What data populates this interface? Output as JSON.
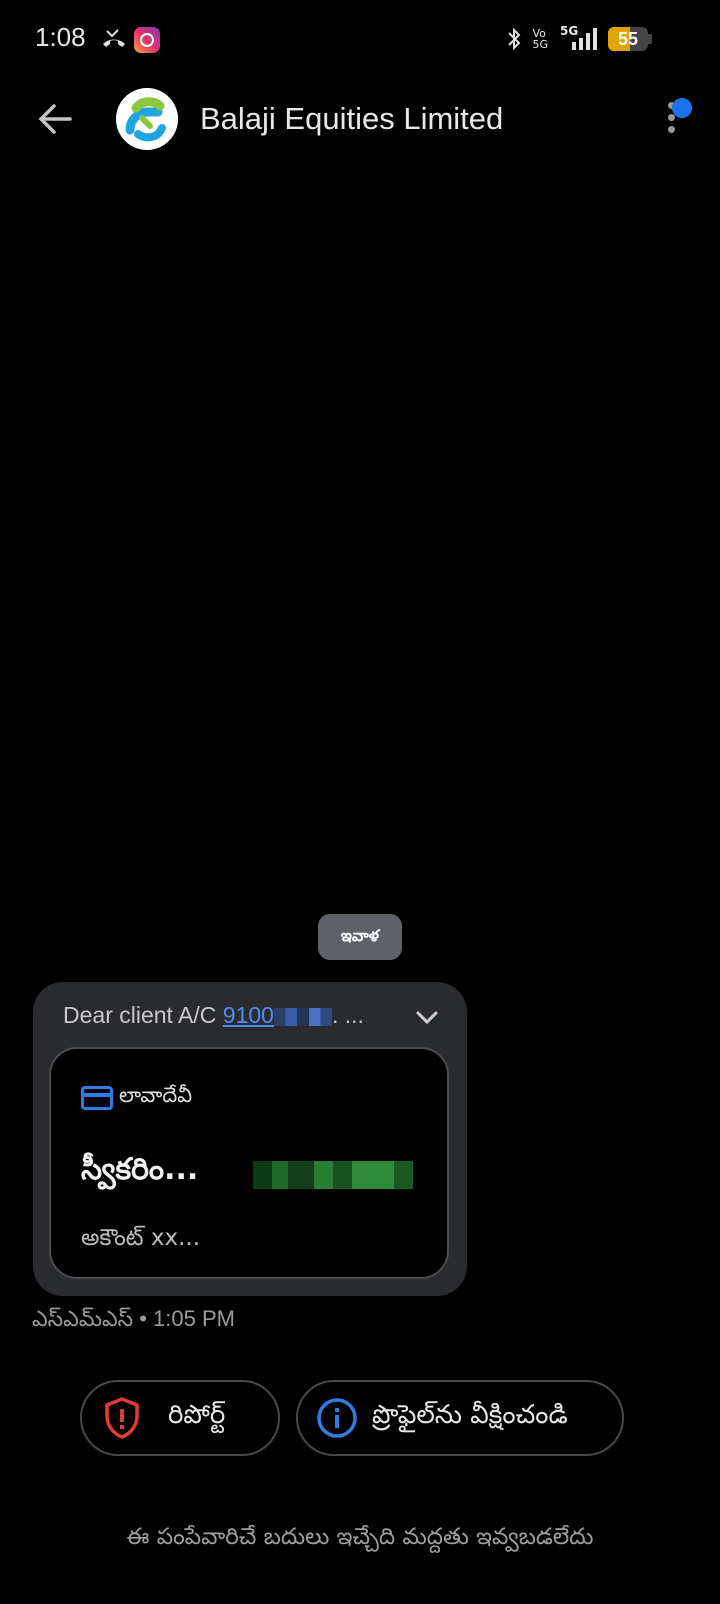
{
  "status_bar": {
    "time": "1:08",
    "network_label_1": "Vo",
    "network_label_2": "5G",
    "network_type": "5G",
    "battery_level": 55,
    "icons": [
      "missed-call-icon",
      "instagram-icon",
      "bluetooth-icon",
      "signal-icon",
      "battery-icon"
    ]
  },
  "header": {
    "title": "Balaji Equities Limited",
    "back_icon": "arrow-left-icon",
    "menu_icon": "more-vert-icon",
    "notification_color": "#1a73e8"
  },
  "conversation": {
    "date_chip": "ఇవాళ",
    "message": {
      "preview_prefix": "Dear client A/C ",
      "account_partial": "9100",
      "preview_suffix": ". ...",
      "card": {
        "category": "లావాదేవీ",
        "title": "స్వీకరిం...",
        "subtitle": "అకౌంట్ xx..."
      }
    },
    "meta": "ఎస్ఎమ్ఎస్ • 1:05 PM"
  },
  "actions": {
    "report_label": "రిపోర్ట్",
    "profile_label": "ప్రొఫైల్‌ను వీక్షించండి"
  },
  "footer": {
    "notice": "ఈ పంపేవారిచే బదులు ఇచ్చేది మద్దతు ఇవ్వబడలేదు"
  },
  "colors": {
    "accent_blue": "#1a73e8",
    "report_red": "#e53935",
    "bubble_bg": "#2a2b2e"
  }
}
